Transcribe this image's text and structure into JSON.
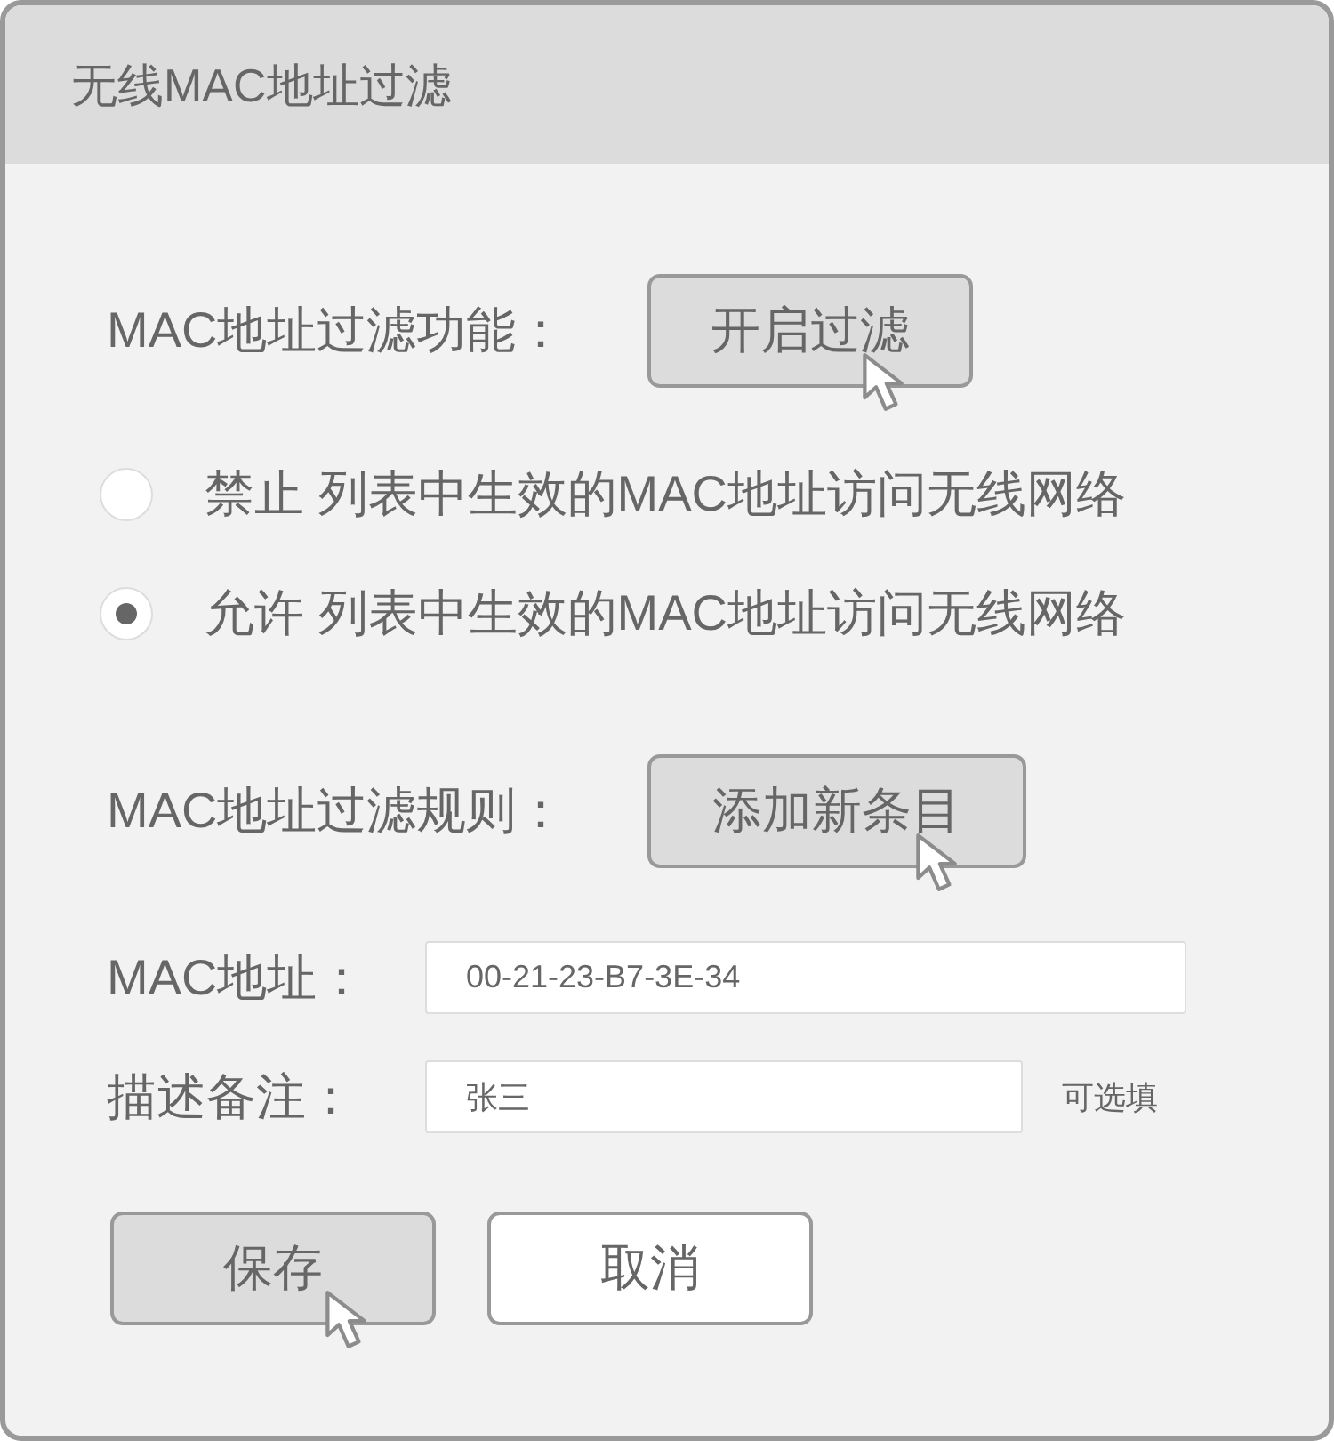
{
  "window": {
    "title": "无线MAC地址过滤"
  },
  "filter_function": {
    "label": "MAC地址过滤功能：",
    "button": {
      "label": "开启过滤",
      "hovered": true
    }
  },
  "radio_options": [
    {
      "label": "禁止 列表中生效的MAC地址访问无线网络",
      "selected": false
    },
    {
      "label": "允许 列表中生效的MAC地址访问无线网络",
      "selected": true
    }
  ],
  "filter_rules": {
    "label": "MAC地址过滤规则：",
    "button": {
      "label": "添加新条目",
      "hovered": true
    }
  },
  "fields": [
    {
      "label": "MAC地址：",
      "value": "00-21-23-B7-3E-34"
    },
    {
      "label": "描述备注：",
      "value": "张三",
      "hint": "可选填"
    }
  ],
  "buttons": [
    {
      "label": "保存",
      "hovered": true
    },
    {
      "label": "取消",
      "hovered": false
    }
  ]
}
